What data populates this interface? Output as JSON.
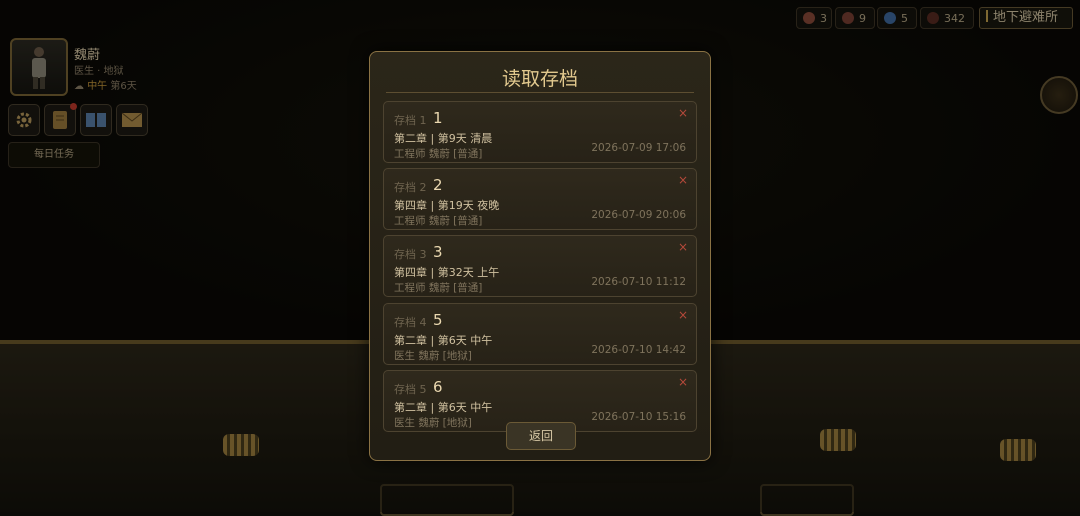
{
  "player": {
    "name": "魏蔚",
    "role": "医生 · 地狱",
    "time_of_day": "中午",
    "day": "第6天",
    "daily_task_label": "每日任务"
  },
  "toolbar_icons": [
    "gear-icon",
    "scroll-icon",
    "book-icon",
    "mail-icon"
  ],
  "resources": [
    {
      "name": "food-icon",
      "value": "3",
      "color": "#8a4a3a"
    },
    {
      "name": "meat-icon",
      "value": "9",
      "color": "#7a4034"
    },
    {
      "name": "gem-icon",
      "value": "5",
      "color": "#3f6aa0"
    },
    {
      "name": "coin-icon",
      "value": "342",
      "color": "#5a2c22"
    }
  ],
  "location": "地下避难所",
  "modal": {
    "title": "读取存档",
    "back_label": "返回",
    "delete_glyph": "×",
    "slots": [
      {
        "slot_label": "存档 1",
        "name": "1",
        "chapter": "第二章 | 第9天 清晨",
        "info": "工程师  魏蔚 [普通]",
        "date": "2026-07-09 17:06"
      },
      {
        "slot_label": "存档 2",
        "name": "2",
        "chapter": "第四章 | 第19天 夜晚",
        "info": "工程师  魏蔚 [普通]",
        "date": "2026-07-09 20:06"
      },
      {
        "slot_label": "存档 3",
        "name": "3",
        "chapter": "第四章 | 第32天 上午",
        "info": "工程师  魏蔚 [普通]",
        "date": "2026-07-10 11:12"
      },
      {
        "slot_label": "存档 4",
        "name": "5",
        "chapter": "第二章 | 第6天 中午",
        "info": "医生  魏蔚 [地狱]",
        "date": "2026-07-10 14:42"
      },
      {
        "slot_label": "存档 5",
        "name": "6",
        "chapter": "第二章 | 第6天 中午",
        "info": "医生  魏蔚 [地狱]",
        "date": "2026-07-10 15:16"
      }
    ]
  }
}
